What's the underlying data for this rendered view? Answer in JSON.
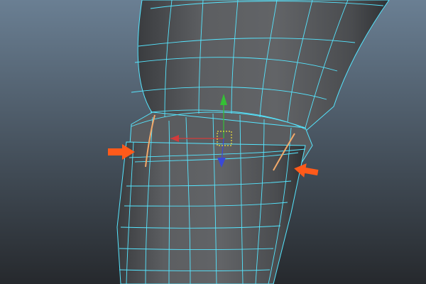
{
  "viewport": {
    "background_top": "#6a7f93",
    "background_bottom": "#26292d",
    "mesh_fill": "#5e6063",
    "mesh_fill_dark": "#3e4043",
    "wireframe_color": "#55e6ff",
    "selected_edge_color": "#f2a96a",
    "arrow_color": "#ff5a1a"
  },
  "manipulator": {
    "x_axis_color": "#d43b3b",
    "y_axis_color": "#35c035",
    "z_axis_color": "#3a49d8",
    "center_color": "#f0e23a",
    "icon": "move-manipulator-icon"
  },
  "annotations": [
    {
      "name": "left-arrow",
      "icon": "arrow-right-icon"
    },
    {
      "name": "right-arrow",
      "icon": "arrow-left-icon"
    }
  ]
}
